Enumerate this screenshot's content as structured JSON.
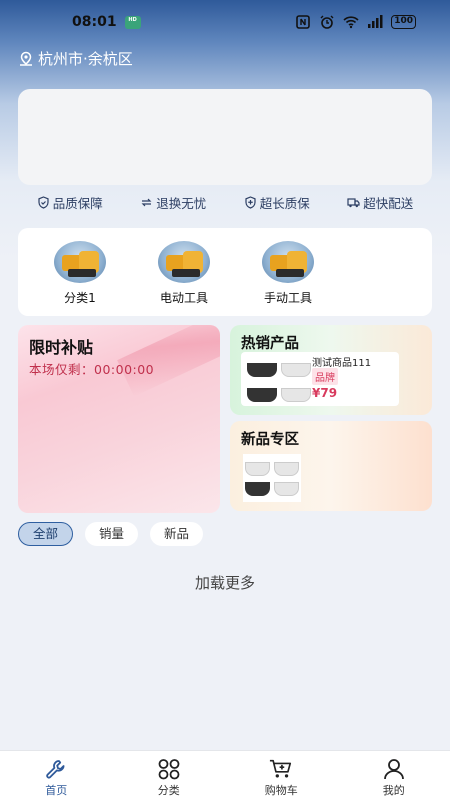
{
  "status_bar": {
    "time": "08:01",
    "badge": "HD",
    "battery": "100"
  },
  "location": {
    "text": "杭州市·余杭区"
  },
  "guarantees": [
    {
      "label": "品质保障"
    },
    {
      "label": "退换无忧"
    },
    {
      "label": "超长质保"
    },
    {
      "label": "超快配送"
    }
  ],
  "categories": [
    {
      "label": "分类1"
    },
    {
      "label": "电动工具"
    },
    {
      "label": "手动工具"
    }
  ],
  "promo_flash": {
    "title": "限时补贴",
    "timer": "本场仅剩：00:00:00"
  },
  "promo_hot": {
    "title": "热销产品",
    "product_name": "测试商品111",
    "tag": "品牌",
    "price": "¥79"
  },
  "promo_new": {
    "title": "新品专区"
  },
  "filters": [
    {
      "label": "全部",
      "active": true
    },
    {
      "label": "销量"
    },
    {
      "label": "新品"
    }
  ],
  "load_more": "加载更多",
  "tabbar": [
    {
      "label": "首页",
      "icon": "wrench-icon",
      "active": true
    },
    {
      "label": "分类",
      "icon": "grid-icon"
    },
    {
      "label": "购物车",
      "icon": "cart-icon"
    },
    {
      "label": "我的",
      "icon": "user-icon"
    }
  ],
  "colors": {
    "accent": "#2f5a9a",
    "price": "#d83a5d",
    "active_filter_bg": "#c3d4ea"
  }
}
